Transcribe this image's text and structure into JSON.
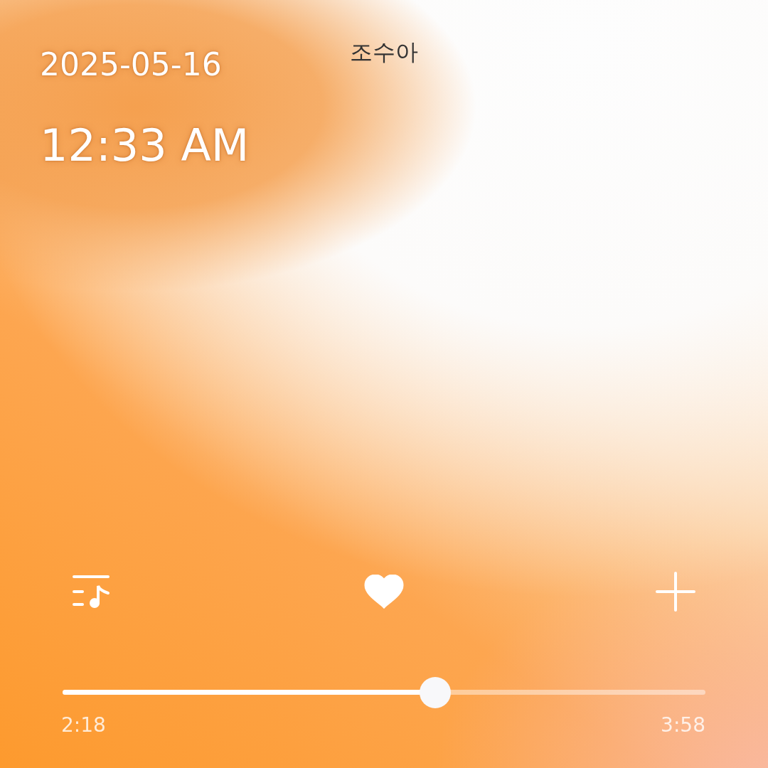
{
  "track": {
    "artist": "조수아"
  },
  "clock": {
    "date": "2025-05-16",
    "time": "12:33 AM"
  },
  "controls": {
    "liked": true
  },
  "progress": {
    "level": 0.58,
    "elapsed": "2:18",
    "duration": "3:58"
  }
}
